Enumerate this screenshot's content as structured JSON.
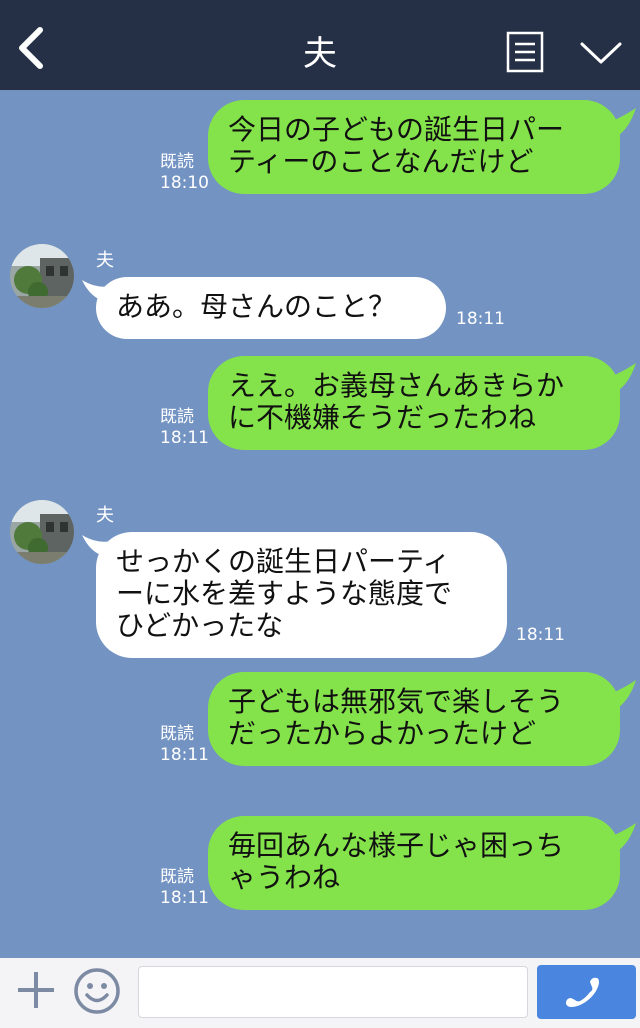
{
  "header": {
    "title": "夫",
    "back_icon": "chevron-left-icon",
    "menu_icon": "document-menu-icon",
    "collapse_icon": "chevron-down-icon"
  },
  "messages": [
    {
      "side": "right",
      "text_lines": [
        "今日の子どもの誕生日パー",
        "ティーのことなんだけど"
      ],
      "read": "既読",
      "time": "18:10"
    },
    {
      "side": "left",
      "sender": "夫",
      "text_lines": [
        "ああ。母さんのこと？"
      ],
      "time": "18:11"
    },
    {
      "side": "right",
      "text_lines": [
        "ええ。お義母さんあきらか",
        "に不機嫌そうだったわね"
      ],
      "read": "既読",
      "time": "18:11"
    },
    {
      "side": "left",
      "sender": "夫",
      "text_lines": [
        "せっかくの誕生日パーティ",
        "ーに水を差すような態度で",
        "ひどかったな"
      ],
      "time": "18:11"
    },
    {
      "side": "right",
      "text_lines": [
        "子どもは無邪気で楽しそう",
        "だったからよかったけど"
      ],
      "read": "既読",
      "time": "18:11"
    },
    {
      "side": "right",
      "text_lines": [
        "毎回あんな様子じゃ困っち",
        "ゃうわね"
      ],
      "read": "既読",
      "time": "18:11"
    }
  ],
  "footer": {
    "plus_icon": "plus-icon",
    "smile_icon": "smiley-icon",
    "input_value": "",
    "call_icon": "phone-icon"
  },
  "colors": {
    "header_bg": "#253047",
    "chat_bg": "#7393c3",
    "green_bubble": "#84e34a",
    "call_button": "#4a86e0"
  }
}
